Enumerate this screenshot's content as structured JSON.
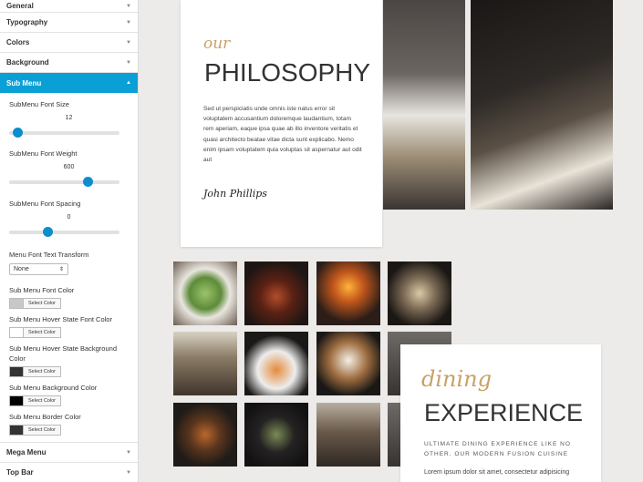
{
  "sidebar": {
    "sections_top": [
      {
        "label": "General"
      },
      {
        "label": "Typography"
      },
      {
        "label": "Colors"
      },
      {
        "label": "Background"
      }
    ],
    "active_section": {
      "label": "Sub Menu"
    },
    "fields": {
      "font_size": {
        "label": "SubMenu Font Size",
        "value": "12"
      },
      "font_weight": {
        "label": "SubMenu Font Weight",
        "value": "600"
      },
      "font_spacing": {
        "label": "SubMenu Font Spacing",
        "value": "0"
      },
      "text_transform": {
        "label": "Menu Font Text Transform",
        "value": "None"
      },
      "colors": [
        {
          "label": "Sub Menu Font Color",
          "button": "Select Color",
          "swatch": "#c8c8c8"
        },
        {
          "label": "Sub Menu Hover State Font Color",
          "button": "Select Color",
          "swatch": "#ffffff"
        },
        {
          "label": "Sub Menu Hover State Background Color",
          "button": "Select Color",
          "swatch": "#333333"
        },
        {
          "label": "Sub Menu Background Color",
          "button": "Select Color",
          "swatch": "#000000"
        },
        {
          "label": "Sub Menu Border Color",
          "button": "Select Color",
          "swatch": "#333333"
        }
      ]
    },
    "sections_bottom": [
      {
        "label": "Mega Menu"
      },
      {
        "label": "Top Bar"
      }
    ],
    "accent_color": "#0aa0d6"
  },
  "philosophy": {
    "script_word": "our",
    "heading": "PHILOSOPHY",
    "body": "Sed ut perspiciatis unde omnis iste natus error sit voluptatem accusantium doloremque laudantium, totam rem aperiam, eaque ipsa quae ab illo inventore veritatis et quasi architecto beatae vitae dicta sunt explicabo. Nemo enim ipsam voluptatem quia voluptas sit aspernatur aut odit aut",
    "signature": "John Phillips"
  },
  "dining": {
    "script_word": "dining",
    "heading": "EXPERIENCE",
    "subheading": "ULTIMATE DINING EXPERIENCE LIKE NO OTHER. OUR MODERN FUSION CUISINE",
    "body": "Lorem ipsum dolor sit amet, consectetur adipisicing"
  }
}
